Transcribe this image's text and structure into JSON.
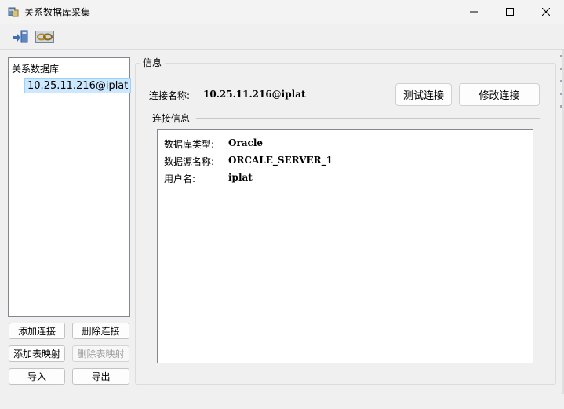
{
  "window": {
    "title": "关系数据库采集",
    "icons": [
      "app-database-icon",
      "minimize-icon",
      "maximize-icon",
      "close-icon"
    ]
  },
  "toolbar": {
    "icons": [
      "export-to-target-icon",
      "link-connection-icon"
    ]
  },
  "tree": {
    "root_label": "关系数据库",
    "nodes": [
      "10.25.11.216@iplat"
    ],
    "selected_index": 0
  },
  "left_buttons": {
    "add_connection": "添加连接",
    "delete_connection": "删除连接",
    "add_table_mapping": "添加表映射",
    "delete_table_mapping": "删除表映射",
    "import": "导入",
    "export": "导出"
  },
  "info": {
    "group_title": "信息",
    "connection_name_label": "连接名称:",
    "connection_name_value": "10.25.11.216@iplat",
    "test_button": "测试连接",
    "modify_button": "修改连接",
    "connection_info_title": "连接信息",
    "details": [
      {
        "label": "数据库类型:",
        "value": "Oracle"
      },
      {
        "label": "数据源名称:",
        "value": "ORCALE_SERVER_1"
      },
      {
        "label": "用户名:",
        "value": "iplat"
      }
    ]
  },
  "colors": {
    "window_bg": "#f0f0f0",
    "selection_bg": "#cce8ff",
    "selection_border": "#99d1ff",
    "disabled_text": "#a0a0a0"
  }
}
